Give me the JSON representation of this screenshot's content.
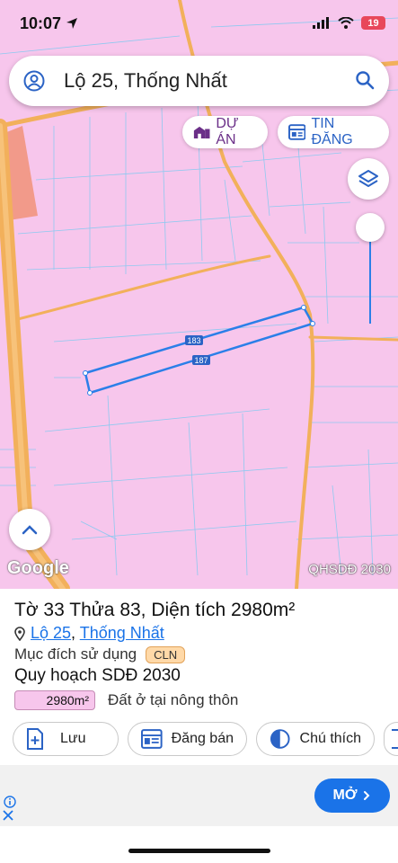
{
  "status": {
    "time": "10:07",
    "battery": "19"
  },
  "search": {
    "query": "Lộ 25, Thống Nhất"
  },
  "chips": {
    "du_an": "DỰ ÁN",
    "tin_dang": "TIN ĐĂNG"
  },
  "map": {
    "google_label": "Google",
    "layer_label": "QHSDĐ 2030",
    "parcel_labels": [
      "183",
      "187"
    ],
    "colors": {
      "land": "#f7c6ec",
      "road": "#f2b05b",
      "boundary": "#8ec9f0",
      "selection": "#2b7fe8"
    }
  },
  "parcel": {
    "title": "Tờ 33 Thửa 83, Diện tích 2980m²",
    "address": {
      "road": "Lộ 25",
      "separator": ",",
      "area": "Thống Nhất"
    },
    "purpose_label": "Mục đích sử dụng",
    "purpose_code": "CLN",
    "plan_title": "Quy hoạch SDĐ 2030",
    "plan_area": "2980m²",
    "plan_type": "Đất ở tại nông thôn"
  },
  "actions": {
    "save": "Lưu",
    "post": "Đăng bán",
    "legend": "Chú thích"
  },
  "ad": {
    "open_label": "MỞ"
  }
}
